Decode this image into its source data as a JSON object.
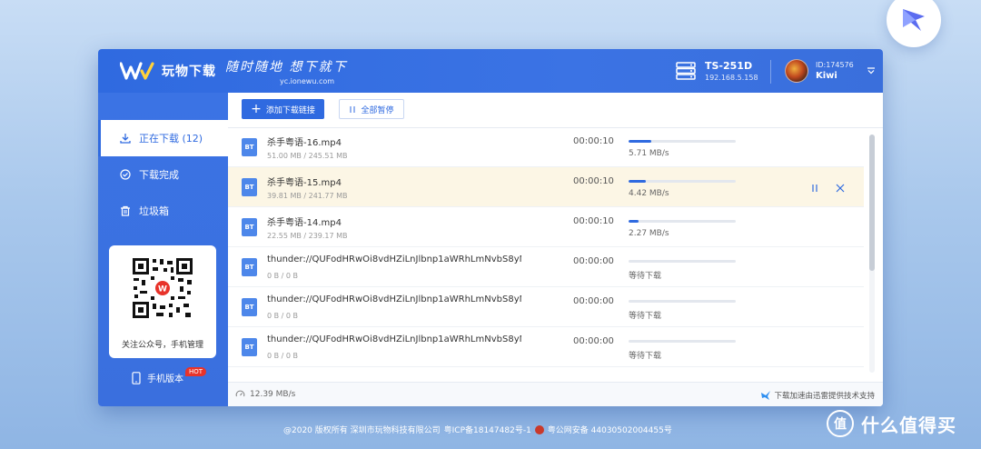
{
  "app": {
    "logo_text": "玩物下载",
    "slogan": "随时随地 想下就下",
    "slogan_url": "yc.ionewu.com"
  },
  "device": {
    "name": "TS-251D",
    "ip": "192.168.5.158"
  },
  "user": {
    "id": "ID:174576",
    "name": "Kiwi"
  },
  "sidebar": {
    "items": [
      {
        "label": "正在下载 (12)",
        "icon": "download-icon",
        "active": true
      },
      {
        "label": "下载完成",
        "icon": "check-circle-icon",
        "active": false
      },
      {
        "label": "垃圾箱",
        "icon": "trash-icon",
        "active": false
      }
    ],
    "qr_caption": "关注公众号，手机管理",
    "mobile_label": "手机版本",
    "hot_badge": "HOT"
  },
  "toolbar": {
    "add_label": "添加下载链接",
    "pause_all_label": "全部暂停"
  },
  "downloads": [
    {
      "icon_text": "BT",
      "name": "杀手粤语-16.mp4",
      "size": "51.00 MB / 245.51 MB",
      "time": "00:00:10",
      "progress": 0.21,
      "status": "5.71 MB/s",
      "highlight": false
    },
    {
      "icon_text": "BT",
      "name": "杀手粤语-15.mp4",
      "size": "39.81 MB / 241.77 MB",
      "time": "00:00:10",
      "progress": 0.16,
      "status": "4.42 MB/s",
      "highlight": true
    },
    {
      "icon_text": "BT",
      "name": "杀手粤语-14.mp4",
      "size": "22.55 MB / 239.17 MB",
      "time": "00:00:10",
      "progress": 0.09,
      "status": "2.27 MB/s",
      "highlight": false
    },
    {
      "icon_text": "BT",
      "name": "thunder://QUFodHRwOi8vdHZiLnJlbnp1aWRhLmNvbS8yM...",
      "size": "0 B / 0 B",
      "time": "00:00:00",
      "progress": 0,
      "status": "等待下载",
      "highlight": false
    },
    {
      "icon_text": "BT",
      "name": "thunder://QUFodHRwOi8vdHZiLnJlbnp1aWRhLmNvbS8yM...",
      "size": "0 B / 0 B",
      "time": "00:00:00",
      "progress": 0,
      "status": "等待下载",
      "highlight": false
    },
    {
      "icon_text": "BT",
      "name": "thunder://QUFodHRwOi8vdHZiLnJlbnp1aWRhLmNvbS8yM...",
      "size": "0 B / 0 B",
      "time": "00:00:00",
      "progress": 0,
      "status": "等待下载",
      "highlight": false
    }
  ],
  "footer": {
    "total_speed": "12.39 MB/s",
    "credit": "下载加速由迅雷提供技术支持"
  },
  "page_footer": {
    "copyright": "@2020 版权所有 深圳市玩物科技有限公司",
    "icp": "粤ICP备18147482号-1",
    "police": "粤公网安备 44030502004455号"
  },
  "watermark": {
    "text": "什么值得买",
    "logo_char": "值"
  },
  "colors": {
    "accent": "#2f6ae0",
    "highlight_row": "#fcf6e5",
    "hot": "#e8332a"
  }
}
